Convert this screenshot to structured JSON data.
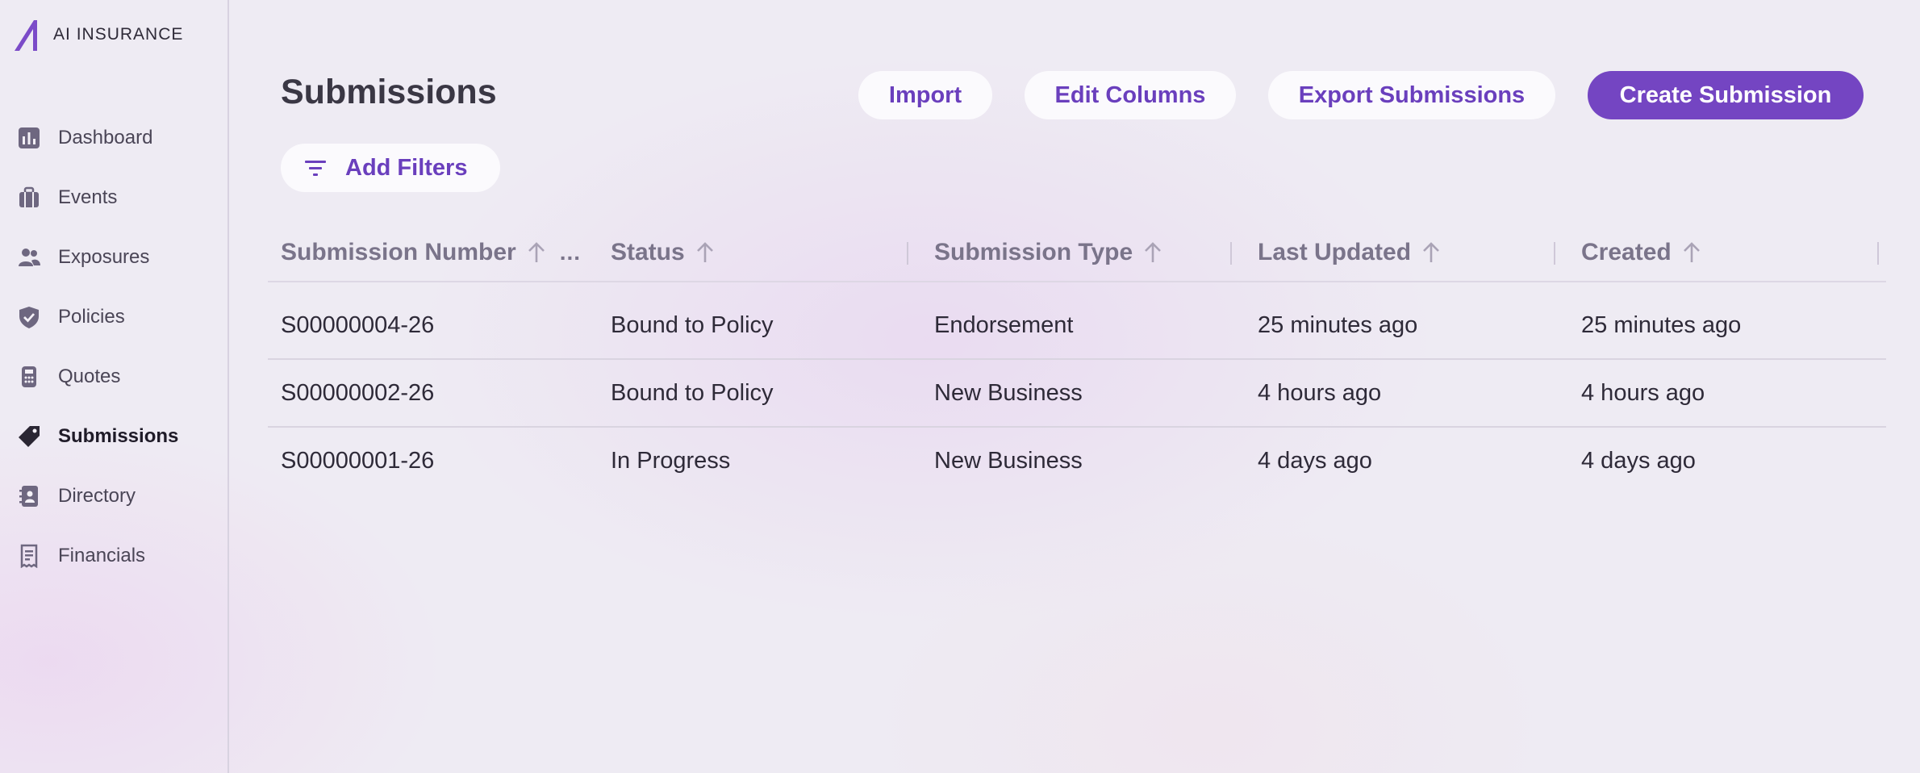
{
  "app": {
    "logo_ai": "AI",
    "logo_text": "INSURANCE"
  },
  "sidebar": {
    "items": [
      {
        "label": "Dashboard",
        "icon": "dashboard-icon",
        "active": false
      },
      {
        "label": "Events",
        "icon": "briefcase-icon",
        "active": false
      },
      {
        "label": "Exposures",
        "icon": "people-icon",
        "active": false
      },
      {
        "label": "Policies",
        "icon": "shield-icon",
        "active": false
      },
      {
        "label": "Quotes",
        "icon": "calculator-icon",
        "active": false
      },
      {
        "label": "Submissions",
        "icon": "tag-icon",
        "active": true
      },
      {
        "label": "Directory",
        "icon": "contact-book-icon",
        "active": false
      },
      {
        "label": "Financials",
        "icon": "receipt-icon",
        "active": false
      }
    ]
  },
  "header": {
    "title": "Submissions",
    "import_label": "Import",
    "edit_columns_label": "Edit Columns",
    "export_label": "Export Submissions",
    "create_label": "Create Submission",
    "add_filters_label": "Add Filters"
  },
  "table": {
    "columns": [
      "Submission Number",
      "Status",
      "Submission Type",
      "Last Updated",
      "Created"
    ],
    "more_label": "...",
    "rows": [
      [
        "S00000004-26",
        "Bound to Policy",
        "Endorsement",
        "25 minutes ago",
        "25 minutes ago"
      ],
      [
        "S00000002-26",
        "Bound to Policy",
        "New Business",
        "4 hours ago",
        "4 hours ago"
      ],
      [
        "S00000001-26",
        "In Progress",
        "New Business",
        "4 days ago",
        "4 days ago"
      ]
    ]
  },
  "colors": {
    "accent": "#7445c2",
    "accent_text": "#6a3fbd",
    "background": "#eeebf3"
  }
}
